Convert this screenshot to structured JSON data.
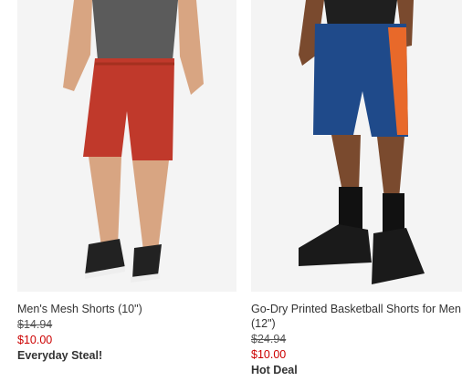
{
  "products": [
    {
      "name": "Men's Mesh Shorts (10\")",
      "original_price": "$14.94",
      "sale_price": "$10.00",
      "badge": "Everyday Steal!",
      "image_icon": "red-mesh-shorts-photo",
      "colors": {
        "shorts": "#c0392b",
        "shirt": "#5a5a5a",
        "skin": "#d4a07c"
      }
    },
    {
      "name": "Go-Dry Printed Basketball Shorts for Men (12\")",
      "original_price": "$24.94",
      "sale_price": "$10.00",
      "badge": "Hot Deal",
      "image_icon": "blue-basketball-shorts-photo",
      "colors": {
        "shorts": "#1f4a8a",
        "accent": "#e8692a",
        "skin": "#7a4a2e"
      }
    }
  ],
  "colors": {
    "sale": "#cc0000",
    "text": "#333333",
    "image_bg": "#f2f2f2"
  }
}
